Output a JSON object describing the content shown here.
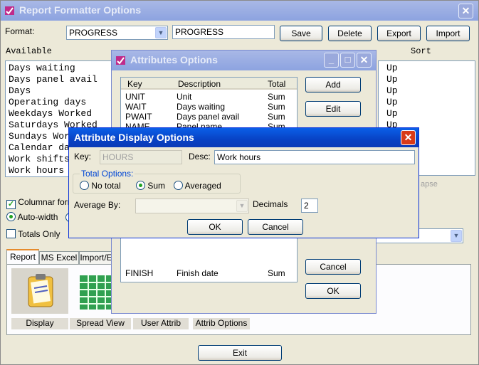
{
  "main": {
    "title": "Report Formatter Options",
    "format_label": "Format:",
    "format_value": "PROGRESS",
    "format_name": "PROGRESS",
    "save": "Save",
    "delete": "Delete",
    "export": "Export",
    "import": "Import",
    "available_label": "Available",
    "sort_label": "Sort",
    "available_items": [
      "Days waiting",
      "Days panel avail",
      "Days",
      "Operating days",
      "Weekdays Worked",
      "Saturdays Worked",
      "Sundays Wor",
      "Calendar da",
      "Work shifts",
      "Work hours"
    ],
    "sort_items": [
      "Up",
      "Up",
      "Up",
      "Up",
      "Up",
      "Up"
    ],
    "collapse_fragment": "apse",
    "columnar_label": "Columnar forma",
    "autowidth_label": "Auto-width",
    "totals_only_label": "Totals Only",
    "tabs": [
      "Report",
      "MS Excel",
      "Import/E"
    ],
    "tiles": [
      "Display",
      "Spread View",
      "User Attrib",
      "Attrib Options"
    ],
    "exit": "Exit"
  },
  "attributes": {
    "title": "Attributes Options",
    "columns": [
      "Key",
      "Description",
      "Total"
    ],
    "rows": [
      {
        "key": "UNIT",
        "desc": "Unit",
        "total": "Sum"
      },
      {
        "key": "WAIT",
        "desc": "Days waiting",
        "total": "Sum"
      },
      {
        "key": "PWAIT",
        "desc": "Days panel avail",
        "total": "Sum"
      },
      {
        "key": "NAME",
        "desc": "Panel name",
        "total": "Sum"
      },
      {
        "key": "FINISH",
        "desc": "Finish date",
        "total": "Sum"
      }
    ],
    "add": "Add",
    "edit": "Edit",
    "cancel": "Cancel",
    "ok": "OK"
  },
  "display": {
    "title": "Attribute Display Options",
    "key_label": "Key:",
    "key_value": "HOURS",
    "desc_label": "Desc:",
    "desc_value": "Work hours",
    "totals_label": "Total Options:",
    "opt_none": "No total",
    "opt_sum": "Sum",
    "opt_avg": "Averaged",
    "avg_by_label": "Average By:",
    "decimals_label": "Decimals",
    "decimals_value": "2",
    "ok": "OK",
    "cancel": "Cancel"
  },
  "colors": {
    "title_active": "#0a5fe8",
    "title_inactive": "#9eb1e5",
    "face": "#ece9d8"
  }
}
